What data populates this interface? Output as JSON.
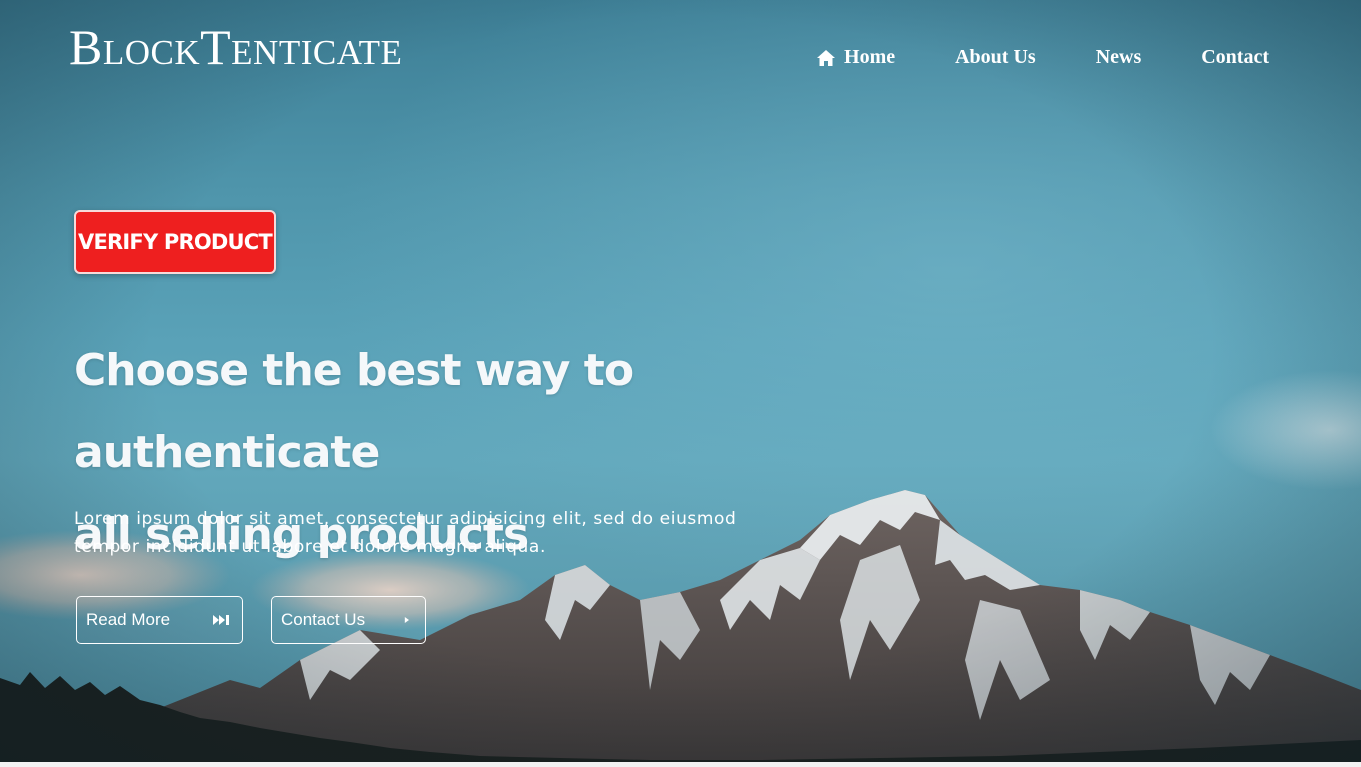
{
  "brand": {
    "name": "BlockTenticate"
  },
  "nav": {
    "home_icon": "home-icon",
    "items": [
      {
        "label": "Home"
      },
      {
        "label": "About Us"
      },
      {
        "label": "News"
      },
      {
        "label": "Contact"
      }
    ]
  },
  "hero": {
    "verify_label": "VERIFY PRODUCT",
    "headline_line1": "Choose the best way to authenticate",
    "headline_line2": "all selling products",
    "subtext_line1": "Lorem ipsum dolor sit amet, consectetur adipisicing elit, sed do eiusmod",
    "subtext_line2": "tempor incididunt ut labore et dolore magna aliqua.",
    "read_more_label": "Read More",
    "read_more_icon": "fast-forward-icon",
    "contact_label": "Contact Us",
    "contact_icon": "caret-right-icon"
  },
  "colors": {
    "verify_button": "#ee1f1f",
    "sky": "#5aa2b8",
    "text": "#ffffff"
  }
}
